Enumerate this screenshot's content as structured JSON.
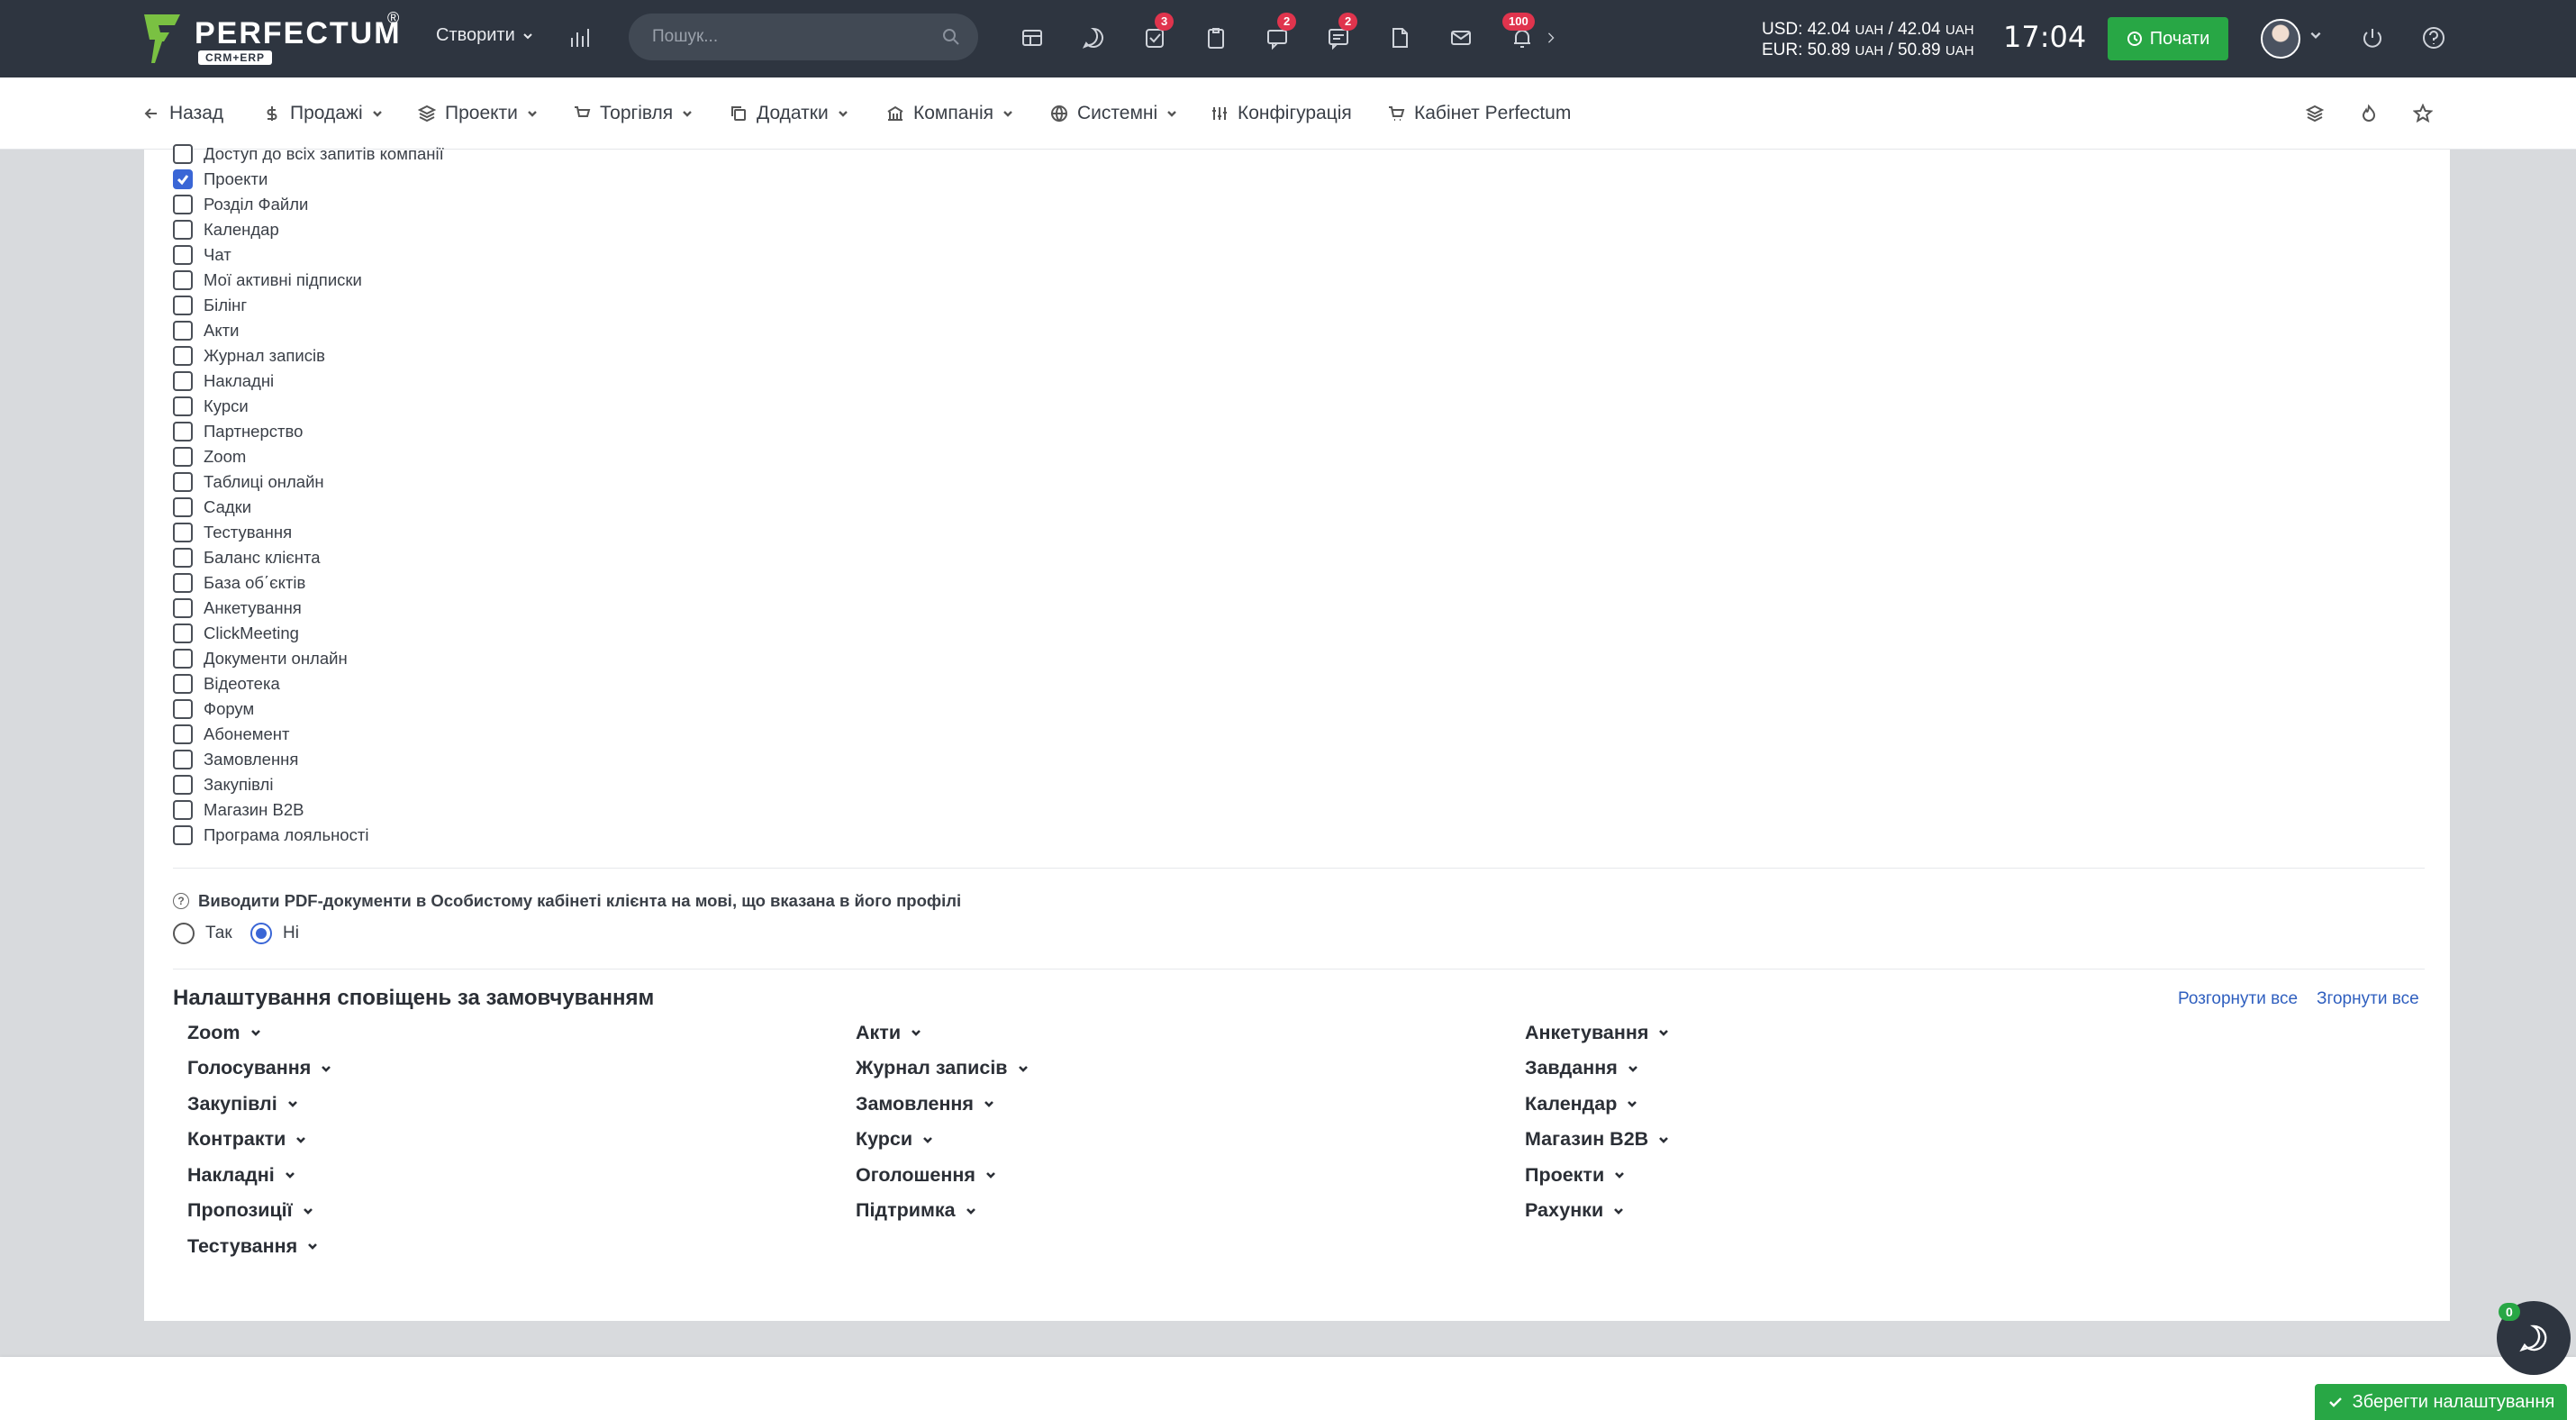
{
  "topbar": {
    "logo_text": "PERFECTUM",
    "logo_sub": "CRM+ERP",
    "logo_reg": "®",
    "create_label": "Створити",
    "search_placeholder": "Пошук...",
    "badges": {
      "tasks": "3",
      "messages": "2",
      "comments": "2",
      "notifications": "100"
    },
    "rates": {
      "usd_label": "USD: 42.04",
      "usd_mid": " / 42.04",
      "eur_label": "EUR: 50.89",
      "eur_mid": " / 50.89",
      "currency": "UAH"
    },
    "clock": "17:04",
    "start_label": "Почати"
  },
  "nav": {
    "back": "Назад",
    "sales": "Продажі",
    "projects": "Проекти",
    "trade": "Торгівля",
    "addons": "Додатки",
    "company": "Компанія",
    "system": "Системні",
    "config": "Конфігурація",
    "cabinet": "Кабінет Perfectum"
  },
  "modules": [
    {
      "label": "Доступ до всіх запитів компанії",
      "checked": false
    },
    {
      "label": "Проекти",
      "checked": true
    },
    {
      "label": "Розділ Файли",
      "checked": false
    },
    {
      "label": "Календар",
      "checked": false
    },
    {
      "label": "Чат",
      "checked": false
    },
    {
      "label": "Мої активні підписки",
      "checked": false
    },
    {
      "label": "Білінг",
      "checked": false
    },
    {
      "label": "Акти",
      "checked": false
    },
    {
      "label": "Журнал записів",
      "checked": false
    },
    {
      "label": "Накладні",
      "checked": false
    },
    {
      "label": "Курси",
      "checked": false
    },
    {
      "label": "Партнерство",
      "checked": false
    },
    {
      "label": "Zoom",
      "checked": false
    },
    {
      "label": "Таблиці онлайн",
      "checked": false
    },
    {
      "label": "Садки",
      "checked": false
    },
    {
      "label": "Тестування",
      "checked": false
    },
    {
      "label": "Баланс клієнта",
      "checked": false
    },
    {
      "label": "База об΄єктів",
      "checked": false
    },
    {
      "label": "Анкетування",
      "checked": false
    },
    {
      "label": "ClickMeeting",
      "checked": false
    },
    {
      "label": "Документи онлайн",
      "checked": false
    },
    {
      "label": "Відеотека",
      "checked": false
    },
    {
      "label": "Форум",
      "checked": false
    },
    {
      "label": "Абонемент",
      "checked": false
    },
    {
      "label": "Замовлення",
      "checked": false
    },
    {
      "label": "Закупівлі",
      "checked": false
    },
    {
      "label": "Магазин B2B",
      "checked": false
    },
    {
      "label": "Програма лояльності",
      "checked": false
    }
  ],
  "pdf_setting": {
    "label": "Виводити PDF-документи в Особистому кабінеті клієнта на мові, що вказана в його профілі",
    "yes": "Так",
    "no": "Ні",
    "selected": "no"
  },
  "notifications": {
    "title": "Налаштування сповіщень за замовчуванням",
    "expand_all": "Розгорнути все",
    "collapse_all": "Згорнути все",
    "columns": [
      [
        "Zoom",
        "Голосування",
        "Закупівлі",
        "Контракти",
        "Накладні",
        "Пропозиції",
        "Тестування"
      ],
      [
        "Акти",
        "Журнал записів",
        "Замовлення",
        "Курси",
        "Оголошення",
        "Підтримка"
      ],
      [
        "Анкетування",
        "Завдання",
        "Календар",
        "Магазин B2B",
        "Проекти",
        "Рахунки"
      ]
    ]
  },
  "footer": {
    "save_label": "Зберегти налаштування",
    "chat_badge": "0"
  },
  "colors": {
    "topbar": "#2e3540",
    "accent_green": "#28a745",
    "link_blue": "#2f5fbf",
    "checkbox_blue": "#3a66d6",
    "badge_red": "#e0344d"
  }
}
